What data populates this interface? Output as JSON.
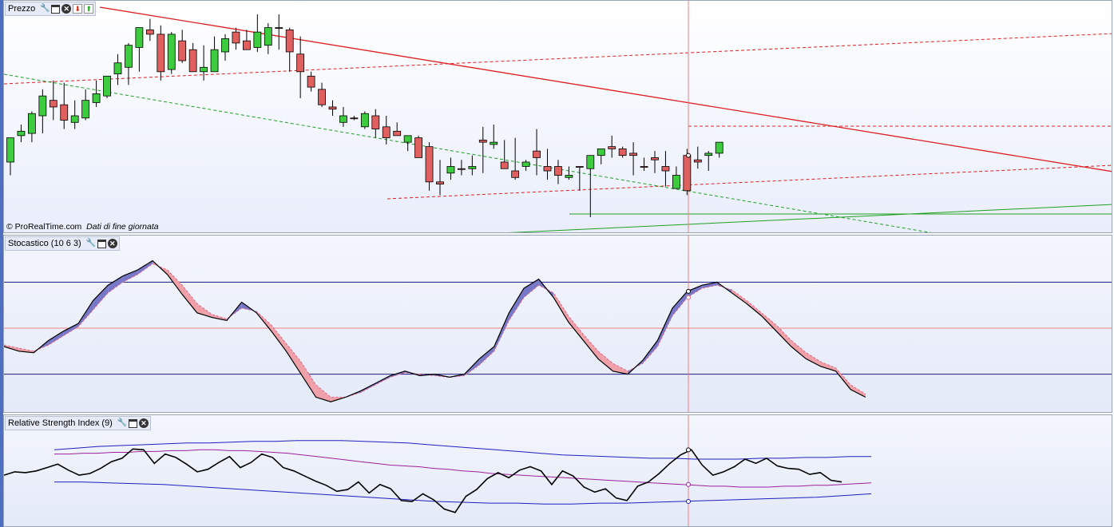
{
  "panels": {
    "price": {
      "title": "Prezzo",
      "copyright": "© ProRealTime.com",
      "note": "Dati di fine giornata"
    },
    "stochastic": {
      "title": "Stocastico (10 6 3)"
    },
    "rsi": {
      "title": "Relative Strength Index (9)"
    }
  },
  "icons": {
    "settings": "wrench-icon",
    "window": "window-icon",
    "close": "close-icon",
    "move_down": "arrow-down-icon",
    "move_up": "arrow-up-icon"
  },
  "colors": {
    "up_candle": "#3dcc3d",
    "down_candle": "#e06060",
    "trendline_red": "#e02020",
    "trendline_green": "#20a020",
    "cursor": "#f08080",
    "stoch_main": "#000000",
    "stoch_signal": "#e06a8a",
    "fill_up": "#7878c8",
    "fill_down": "#f0a0a8",
    "rsi_line": "#000000",
    "rsi_mid": "#a020a0",
    "rsi_bands": "#2020c0"
  },
  "chart_data": [
    {
      "type": "candlestick",
      "title": "Prezzo",
      "y_scale": "price (no axis shown)",
      "candles": [
        {
          "o": 0.71,
          "h": 0.63,
          "l": 0.77,
          "c": 0.6
        },
        {
          "o": 0.59,
          "h": 0.54,
          "l": 0.62,
          "c": 0.57
        },
        {
          "o": 0.58,
          "h": 0.48,
          "l": 0.62,
          "c": 0.49
        },
        {
          "o": 0.5,
          "h": 0.38,
          "l": 0.58,
          "c": 0.41
        },
        {
          "o": 0.43,
          "h": 0.34,
          "l": 0.52,
          "c": 0.46
        },
        {
          "o": 0.45,
          "h": 0.35,
          "l": 0.56,
          "c": 0.52
        },
        {
          "o": 0.53,
          "h": 0.43,
          "l": 0.56,
          "c": 0.5
        },
        {
          "o": 0.51,
          "h": 0.38,
          "l": 0.52,
          "c": 0.43
        },
        {
          "o": 0.44,
          "h": 0.34,
          "l": 0.46,
          "c": 0.4
        },
        {
          "o": 0.41,
          "h": 0.32,
          "l": 0.42,
          "c": 0.32
        },
        {
          "o": 0.31,
          "h": 0.22,
          "l": 0.36,
          "c": 0.26
        },
        {
          "o": 0.28,
          "h": 0.17,
          "l": 0.36,
          "c": 0.18
        },
        {
          "o": 0.19,
          "h": 0.1,
          "l": 0.3,
          "c": 0.1
        },
        {
          "o": 0.11,
          "h": 0.06,
          "l": 0.16,
          "c": 0.13
        },
        {
          "o": 0.13,
          "h": 0.09,
          "l": 0.34,
          "c": 0.3
        },
        {
          "o": 0.29,
          "h": 0.12,
          "l": 0.31,
          "c": 0.13
        },
        {
          "o": 0.16,
          "h": 0.11,
          "l": 0.26,
          "c": 0.25
        },
        {
          "o": 0.2,
          "h": 0.17,
          "l": 0.3,
          "c": 0.3
        },
        {
          "o": 0.3,
          "h": 0.18,
          "l": 0.34,
          "c": 0.28
        },
        {
          "o": 0.3,
          "h": 0.14,
          "l": 0.3,
          "c": 0.2
        },
        {
          "o": 0.21,
          "h": 0.13,
          "l": 0.25,
          "c": 0.15
        },
        {
          "o": 0.12,
          "h": 0.1,
          "l": 0.2,
          "c": 0.17
        },
        {
          "o": 0.16,
          "h": 0.11,
          "l": 0.2,
          "c": 0.2
        },
        {
          "o": 0.19,
          "h": 0.04,
          "l": 0.21,
          "c": 0.12
        },
        {
          "o": 0.18,
          "h": 0.08,
          "l": 0.22,
          "c": 0.1
        },
        {
          "o": 0.1,
          "h": 0.04,
          "l": 0.2,
          "c": 0.1
        },
        {
          "o": 0.11,
          "h": 0.1,
          "l": 0.3,
          "c": 0.21
        },
        {
          "o": 0.22,
          "h": 0.14,
          "l": 0.42,
          "c": 0.3
        },
        {
          "o": 0.32,
          "h": 0.3,
          "l": 0.39,
          "c": 0.37
        },
        {
          "o": 0.38,
          "h": 0.35,
          "l": 0.46,
          "c": 0.45
        },
        {
          "o": 0.46,
          "h": 0.43,
          "l": 0.5,
          "c": 0.47
        },
        {
          "o": 0.53,
          "h": 0.46,
          "l": 0.55,
          "c": 0.5
        },
        {
          "o": 0.51,
          "h": 0.5,
          "l": 0.52,
          "c": 0.51
        },
        {
          "o": 0.55,
          "h": 0.48,
          "l": 0.56,
          "c": 0.49
        },
        {
          "o": 0.5,
          "h": 0.47,
          "l": 0.6,
          "c": 0.56
        },
        {
          "o": 0.55,
          "h": 0.5,
          "l": 0.63,
          "c": 0.6
        },
        {
          "o": 0.57,
          "h": 0.53,
          "l": 0.59,
          "c": 0.59
        },
        {
          "o": 0.62,
          "h": 0.59,
          "l": 0.66,
          "c": 0.59
        },
        {
          "o": 0.6,
          "h": 0.59,
          "l": 0.69,
          "c": 0.69
        },
        {
          "o": 0.64,
          "h": 0.62,
          "l": 0.84,
          "c": 0.8
        },
        {
          "o": 0.8,
          "h": 0.7,
          "l": 0.86,
          "c": 0.81
        },
        {
          "o": 0.76,
          "h": 0.69,
          "l": 0.79,
          "c": 0.73
        },
        {
          "o": 0.74,
          "h": 0.7,
          "l": 0.77,
          "c": 0.74
        },
        {
          "o": 0.74,
          "h": 0.68,
          "l": 0.77,
          "c": 0.73
        },
        {
          "o": 0.61,
          "h": 0.55,
          "l": 0.76,
          "c": 0.62
        },
        {
          "o": 0.63,
          "h": 0.54,
          "l": 0.65,
          "c": 0.62
        },
        {
          "o": 0.71,
          "h": 0.61,
          "l": 0.74,
          "c": 0.74
        },
        {
          "o": 0.75,
          "h": 0.6,
          "l": 0.79,
          "c": 0.78
        },
        {
          "o": 0.73,
          "h": 0.7,
          "l": 0.75,
          "c": 0.71
        },
        {
          "o": 0.66,
          "h": 0.56,
          "l": 0.77,
          "c": 0.69
        },
        {
          "o": 0.73,
          "h": 0.65,
          "l": 0.79,
          "c": 0.75
        },
        {
          "o": 0.73,
          "h": 0.7,
          "l": 0.81,
          "c": 0.77
        },
        {
          "o": 0.78,
          "h": 0.73,
          "l": 0.79,
          "c": 0.77
        },
        {
          "o": 0.73,
          "h": 0.73,
          "l": 0.84,
          "c": 0.73
        },
        {
          "o": 0.74,
          "h": 0.71,
          "l": 0.96,
          "c": 0.68
        },
        {
          "o": 0.68,
          "h": 0.65,
          "l": 0.72,
          "c": 0.65
        },
        {
          "o": 0.64,
          "h": 0.59,
          "l": 0.69,
          "c": 0.65
        },
        {
          "o": 0.65,
          "h": 0.64,
          "l": 0.69,
          "c": 0.68
        },
        {
          "o": 0.67,
          "h": 0.62,
          "l": 0.77,
          "c": 0.68
        },
        {
          "o": 0.73,
          "h": 0.69,
          "l": 0.75,
          "c": 0.73
        },
        {
          "o": 0.69,
          "h": 0.66,
          "l": 0.76,
          "c": 0.7
        },
        {
          "o": 0.73,
          "h": 0.66,
          "l": 0.82,
          "c": 0.75
        },
        {
          "o": 0.83,
          "h": 0.73,
          "l": 0.83,
          "c": 0.77
        },
        {
          "o": 0.68,
          "h": 0.65,
          "l": 0.86,
          "c": 0.84
        },
        {
          "o": 0.7,
          "h": 0.64,
          "l": 0.74,
          "c": 0.71
        },
        {
          "o": 0.68,
          "h": 0.66,
          "l": 0.75,
          "c": 0.67
        },
        {
          "o": 0.67,
          "h": 0.63,
          "l": 0.69,
          "c": 0.62
        }
      ]
    },
    {
      "type": "line",
      "title": "Stocastico (10 6 3)",
      "y_range": [
        0,
        100
      ],
      "levels": [
        80,
        50,
        20
      ],
      "series": [
        {
          "values": [
            38,
            35,
            34,
            42,
            48,
            53,
            68,
            78,
            84,
            88,
            94,
            85,
            72,
            60,
            57,
            55,
            67,
            60,
            48,
            35,
            20,
            5,
            2,
            5,
            9,
            14,
            19,
            22,
            19,
            20,
            18,
            20,
            30,
            38,
            60,
            76,
            82,
            70,
            54,
            42,
            30,
            22,
            20,
            29,
            42,
            63,
            74,
            78,
            80,
            73,
            66,
            58,
            48,
            38,
            30,
            25,
            22,
            10,
            5
          ]
        },
        {
          "values": [
            39,
            37,
            35,
            39,
            45,
            51,
            62,
            73,
            80,
            85,
            92,
            88,
            78,
            66,
            59,
            56,
            63,
            61,
            52,
            40,
            28,
            13,
            5,
            5,
            8,
            13,
            18,
            21,
            20,
            19,
            18,
            19,
            26,
            35,
            55,
            70,
            78,
            73,
            58,
            46,
            35,
            27,
            22,
            27,
            38,
            58,
            70,
            76,
            78,
            75,
            68,
            60,
            52,
            42,
            34,
            28,
            24,
            13,
            7
          ]
        }
      ]
    },
    {
      "type": "line",
      "title": "Relative Strength Index (9)",
      "series": [
        {
          "values": [
            48,
            52,
            51,
            53,
            57,
            61,
            54,
            48,
            50,
            56,
            64,
            68,
            79,
            78,
            62,
            73,
            69,
            61,
            52,
            55,
            63,
            70,
            57,
            63,
            73,
            69,
            57,
            53,
            47,
            41,
            36,
            29,
            31,
            40,
            27,
            37,
            32,
            18,
            17,
            26,
            19,
            8,
            4,
            23,
            31,
            44,
            51,
            45,
            54,
            58,
            53,
            37,
            53,
            47,
            34,
            28,
            32,
            21,
            18,
            35,
            40,
            50,
            62,
            72,
            78,
            60,
            48,
            52,
            58,
            67,
            62,
            68,
            59,
            56,
            55,
            49,
            51,
            42,
            40
          ]
        },
        {
          "values": [
            73,
            73,
            74,
            74,
            75,
            75,
            76,
            76,
            77,
            77,
            78,
            78,
            77,
            77,
            76,
            75,
            74,
            72,
            70,
            68,
            66,
            64,
            62,
            60,
            59,
            58,
            56,
            55,
            53,
            52,
            50,
            49,
            48,
            47,
            46,
            45,
            44,
            43,
            42,
            41,
            40,
            39,
            38,
            37,
            36,
            35,
            35,
            34,
            34,
            34,
            35,
            35,
            36,
            36,
            37,
            38,
            39
          ]
        },
        {
          "values": [
            78,
            80,
            82,
            83,
            84,
            85,
            86,
            86,
            87,
            88,
            88,
            89,
            89,
            89,
            88,
            87,
            86,
            84,
            82,
            80,
            78,
            76,
            74,
            72,
            71,
            70,
            69,
            68,
            68,
            67,
            67,
            67,
            68,
            68,
            69,
            69,
            70,
            70
          ]
        },
        {
          "values": [
            40,
            40,
            39,
            38,
            37,
            35,
            33,
            31,
            29,
            27,
            25,
            23,
            21,
            19,
            17,
            16,
            15,
            15,
            14,
            14,
            15,
            15,
            16,
            17,
            18,
            19,
            20,
            21,
            22,
            24,
            26
          ]
        }
      ]
    }
  ]
}
